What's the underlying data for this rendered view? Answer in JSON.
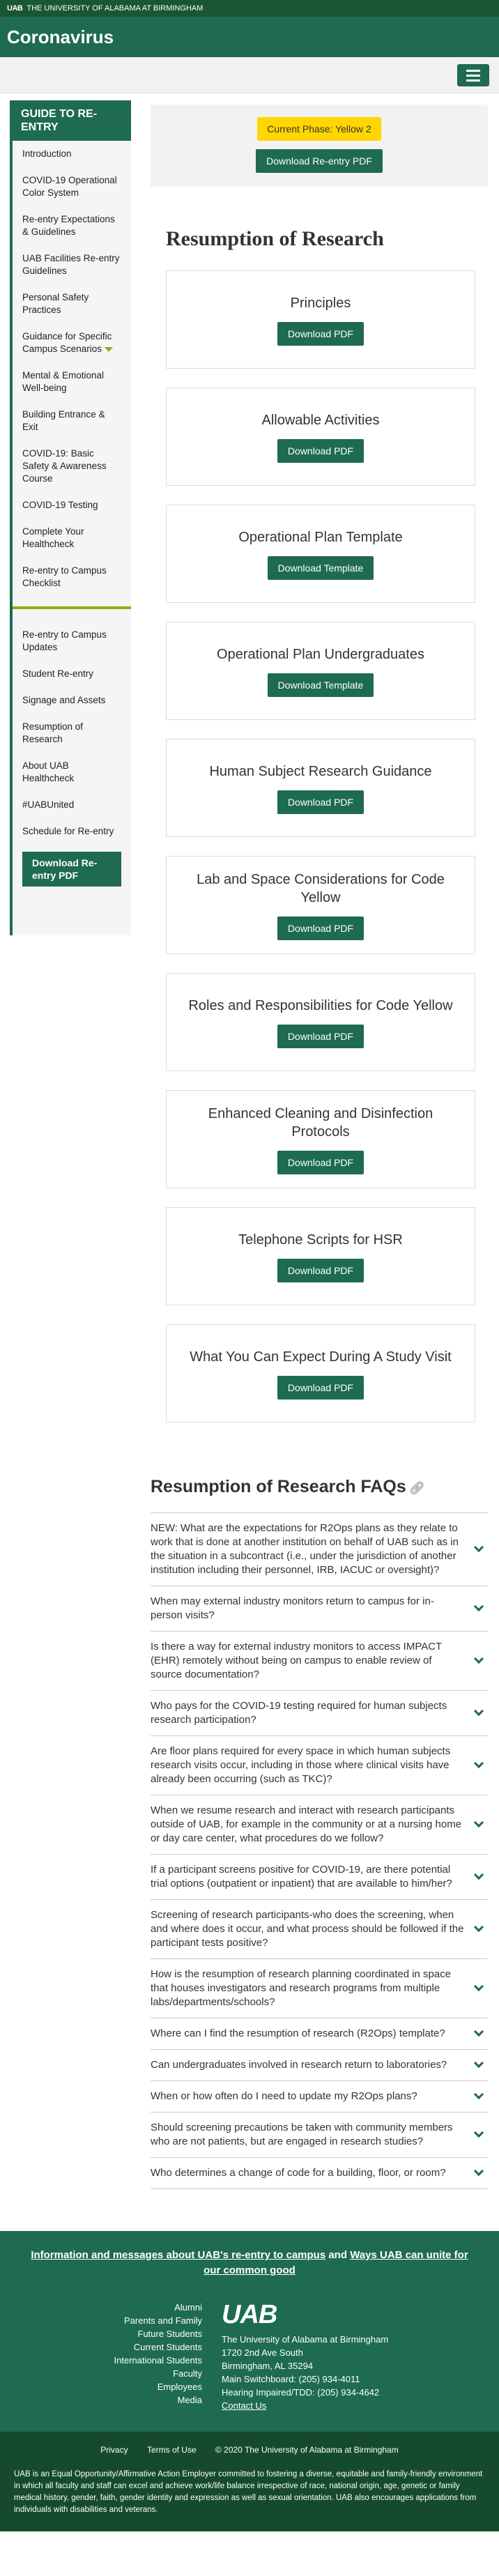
{
  "header": {
    "university_mark": "UAB",
    "university_name": "THE UNIVERSITY OF ALABAMA AT BIRMINGHAM",
    "site_title": "Coronavirus"
  },
  "sidebar": {
    "guide_title": "GUIDE TO RE-ENTRY",
    "items": [
      "Introduction",
      "COVID-19 Operational Color System",
      "Re-entry Expectations & Guidelines",
      "UAB Facilities Re-entry Guidelines",
      "Personal Safety Practices",
      "Guidance for Specific Campus Scenarios",
      "Mental & Emotional Well-being",
      "Building Entrance & Exit",
      "COVID-19: Basic Safety & Awareness Course",
      "COVID-19 Testing",
      "Complete Your Healthcheck",
      "Re-entry to Campus Checklist"
    ],
    "items2": [
      "Re-entry to Campus Updates",
      "Student Re-entry",
      "Signage and Assets",
      "Resumption of Research",
      "About UAB Healthcheck",
      "#UABUnited",
      "Schedule for Re-entry"
    ],
    "download_label": "Download Re-entry PDF"
  },
  "phase": {
    "badge": "Current Phase: Yellow 2",
    "download_label": "Download Re-entry PDF"
  },
  "research": {
    "title": "Resumption of Research",
    "cards": [
      {
        "title": "Principles",
        "button": "Download PDF"
      },
      {
        "title": "Allowable Activities",
        "button": "Download PDF"
      },
      {
        "title": "Operational Plan Template",
        "button": "Download Template"
      },
      {
        "title": "Operational Plan Undergraduates",
        "button": "Download Template"
      },
      {
        "title": "Human Subject Research Guidance",
        "button": "Download PDF"
      },
      {
        "title": "Lab and Space Considerations for Code Yellow",
        "button": "Download PDF"
      },
      {
        "title": "Roles and Responsibilities for Code Yellow",
        "button": "Download PDF"
      },
      {
        "title": "Enhanced Cleaning and Disinfection Protocols",
        "button": "Download PDF"
      },
      {
        "title": "Telephone Scripts for HSR",
        "button": "Download PDF"
      },
      {
        "title": "What You Can Expect During A Study Visit",
        "button": "Download PDF"
      }
    ]
  },
  "faq": {
    "title": "Resumption of Research FAQs",
    "items": [
      "NEW: What are the expectations for R2Ops plans as they relate to work that is done at another institution on behalf of UAB such as in the situation in a subcontract (i.e., under the jurisdiction of another institution including their personnel, IRB, IACUC or oversight)?",
      "When may external industry monitors return to campus for in-person visits?",
      "Is there a way for external industry monitors to access IMPACT (EHR) remotely without being on campus to enable review of source documentation?",
      "Who pays for the COVID-19 testing required for human subjects research participation?",
      "Are floor plans required for every space in which human subjects research visits occur, including in those where clinical visits have already been occurring (such as TKC)?",
      "When we resume research and interact with research participants outside of UAB, for example in the community or at a nursing home or day care center, what procedures do we follow?",
      "If a participant screens positive for COVID-19, are there potential trial options (outpatient or inpatient) that are available to him/her?",
      "Screening of research participants-who does the screening, when and where does it occur, and what process should be followed if the participant tests positive?",
      "How is the resumption of research planning coordinated in space that houses investigators and research programs from multiple labs/departments/schools?",
      "Where can I find the resumption of research (R2Ops) template?",
      "Can undergraduates involved in research return to laboratories?",
      "When or how often do I need to update my R2Ops plans?",
      "Should screening precautions be taken with community members who are not patients, but are engaged in research studies?",
      "Who determines a change of code for a building, floor, or room?"
    ]
  },
  "footer": {
    "info_link1": "Information and messages about UAB's re-entry to campus",
    "info_and": "and",
    "info_link2": "Ways UAB can unite for our common good",
    "links": [
      "Alumni",
      "Parents and Family",
      "Future Students",
      "Current Students",
      "International Students",
      "Faculty",
      "Employees",
      "Media"
    ],
    "logo": "UAB",
    "address": [
      "The University of Alabama at Birmingham",
      "1720 2nd Ave South",
      "Birmingham, AL 35294",
      "Main Switchboard: (205) 934-4011",
      "Hearing Impaired/TDD: (205) 934-4642"
    ],
    "contact": "Contact Us",
    "legal": {
      "privacy": "Privacy",
      "terms": "Terms of Use",
      "copyright": "© 2020 The University of Alabama at Birmingham"
    },
    "eeo": "UAB is an Equal Opportunity/Affirmative Action Employer committed to fostering a diverse, equitable and family-friendly environment in which all faculty and staff can excel and achieve work/life balance irrespective of race, national origin, age, genetic or family medical history, gender, faith, gender identity and expression as well as sexual orientation. UAB also encourages applications from individuals with disabilities and veterans."
  }
}
